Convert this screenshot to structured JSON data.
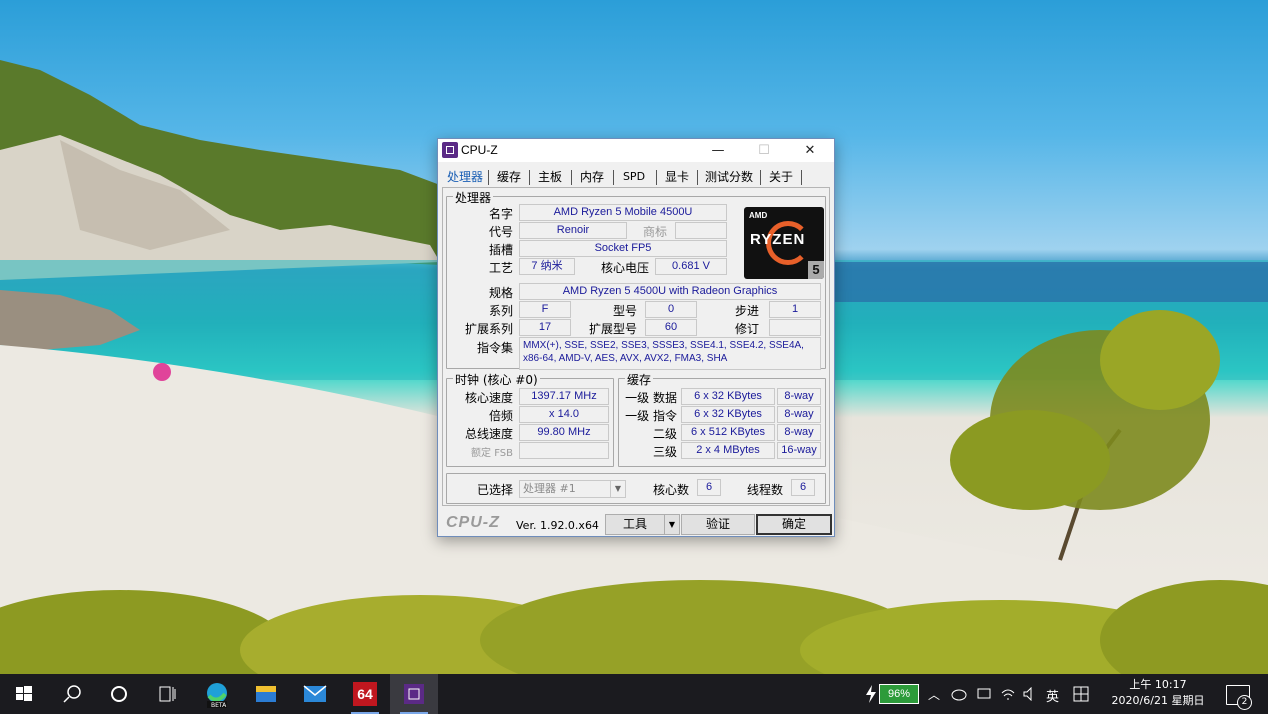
{
  "window": {
    "title": "CPU-Z",
    "controls": {
      "minimize": "—",
      "maximize": "☐",
      "close": "✕"
    }
  },
  "tabs": [
    "处理器",
    "缓存",
    "主板",
    "内存",
    "SPD",
    "显卡",
    "测试分数",
    "关于"
  ],
  "selected_tab": "处理器",
  "processor": {
    "group_label": "处理器",
    "name_label": "名字",
    "name": "AMD Ryzen 5 Mobile 4500U",
    "codename_label": "代号",
    "codename": "Renoir",
    "brand_label": "商标",
    "brand": "",
    "socket_label": "插槽",
    "socket": "Socket FP5",
    "tech_label": "工艺",
    "tech": "7 纳米",
    "voltage_label": "核心电压",
    "voltage": "0.681 V",
    "spec_label": "规格",
    "spec": "AMD Ryzen 5 4500U with Radeon Graphics",
    "family_label": "系列",
    "family": "F",
    "model_label": "型号",
    "model": "0",
    "stepping_label": "步进",
    "stepping": "1",
    "ext_family_label": "扩展系列",
    "ext_family": "17",
    "ext_model_label": "扩展型号",
    "ext_model": "60",
    "revision_label": "修订",
    "revision": "",
    "instructions_label": "指令集",
    "instructions": "MMX(+), SSE, SSE2, SSE3, SSSE3, SSE4.1, SSE4.2, SSE4A, x86-64, AMD-V, AES, AVX, AVX2, FMA3, SHA",
    "logo": {
      "brand": "AMD",
      "text": "RYZEN",
      "tier": "5",
      "icon": "amd-ryzen-5-logo"
    }
  },
  "clocks": {
    "group_label": "时钟 (核心 #0)",
    "core_speed_label": "核心速度",
    "core_speed": "1397.17 MHz",
    "multiplier_label": "倍频",
    "multiplier": "x 14.0",
    "bus_speed_label": "总线速度",
    "bus_speed": "99.80 MHz",
    "rated_fsb_label": "额定 FSB",
    "rated_fsb": ""
  },
  "cache": {
    "group_label": "缓存",
    "rows": [
      {
        "label": "一级 数据",
        "size": "6 x 32 KBytes",
        "way": "8-way"
      },
      {
        "label": "一级 指令",
        "size": "6 x 32 KBytes",
        "way": "8-way"
      },
      {
        "label": "二级",
        "size": "6 x 512 KBytes",
        "way": "8-way"
      },
      {
        "label": "三级",
        "size": "2 x 4 MBytes",
        "way": "16-way"
      }
    ]
  },
  "selection": {
    "selected_label": "已选择",
    "selected_value": "处理器 #1",
    "cores_label": "核心数",
    "cores": "6",
    "threads_label": "线程数",
    "threads": "6"
  },
  "footer": {
    "logo": "CPU-Z",
    "version": "Ver. 1.92.0.x64",
    "tools_label": "工具",
    "validate_label": "验证",
    "ok_label": "确定"
  },
  "taskbar": {
    "apps": [
      "start-icon",
      "search-icon",
      "cortana-icon",
      "task-view-icon",
      "edge-beta-icon",
      "file-explorer-icon",
      "mail-icon",
      "aida64-icon",
      "cpu-z-icon"
    ],
    "aida_label": "64",
    "battery": "96%",
    "ime": "英",
    "time": "上午 10:17",
    "date": "2020/6/21 星期日",
    "notifications": "2"
  }
}
